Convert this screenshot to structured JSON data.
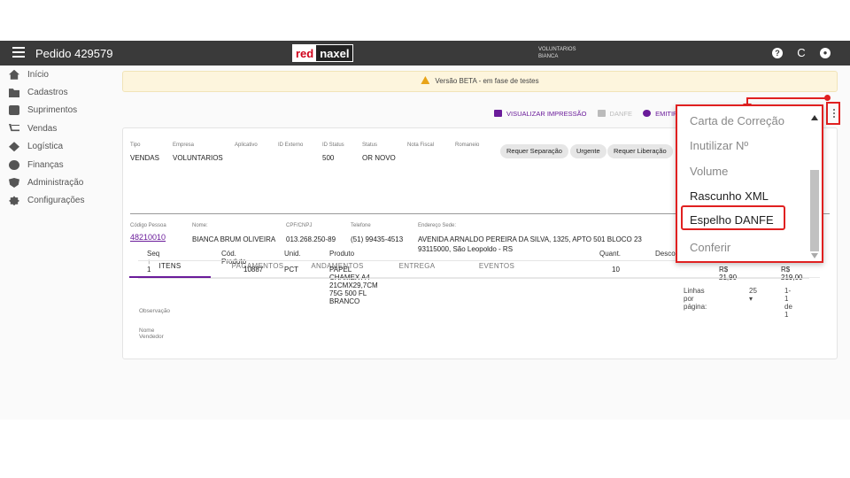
{
  "topbar": {
    "title": "Pedido 429579",
    "logo_red": "red",
    "logo_black": "naxel",
    "user_line1": "VOLUNTARIOS",
    "user_line2": "BIANCA",
    "help_glyph": "?",
    "refresh_glyph": "C",
    "account_glyph": "●"
  },
  "sidebar": {
    "items": [
      {
        "label": "Início",
        "icon": "home-icon"
      },
      {
        "label": "Cadastros",
        "icon": "folder-icon"
      },
      {
        "label": "Suprimentos",
        "icon": "box-icon"
      },
      {
        "label": "Vendas",
        "icon": "cart-icon"
      },
      {
        "label": "Logística",
        "icon": "diamond-icon"
      },
      {
        "label": "Finanças",
        "icon": "dollar-icon"
      },
      {
        "label": "Administração",
        "icon": "shield-icon"
      },
      {
        "label": "Configurações",
        "icon": "gear-icon"
      }
    ]
  },
  "beta_banner": "Versão BETA - em fase de testes",
  "actions": {
    "print": "VISUALIZAR IMPRESSÃO",
    "danfe": "DANFE",
    "emit": "EMITIR PE"
  },
  "order": {
    "tipo_label": "Tipo",
    "tipo": "VENDAS",
    "empresa_label": "Empresa",
    "empresa": "VOLUNTARIOS",
    "aplicativo_label": "Aplicativo",
    "id_externo_label": "ID Externo",
    "id_status_label": "ID Status",
    "id_status": "500",
    "status_label": "Status",
    "status": "OR NOVO",
    "nota_label": "Nota Fiscal",
    "romaneio_label": "Romaneio",
    "chips": [
      "Requer Separação",
      "Urgente",
      "Requer Liberação"
    ]
  },
  "customer": {
    "codigo_label": "Código Pessoa",
    "codigo": "48210010",
    "nome_label": "Nome:",
    "nome": "BIANCA BRUM OLIVEIRA",
    "cpf_label": "CPF/CNPJ",
    "cpf": "013.268.250-89",
    "telefone_label": "Telefone",
    "telefone": "(51) 99435-4513",
    "endereco_label": "Endereço Sede:",
    "endereco_1": "AVENIDA ARNALDO PEREIRA DA SILVA, 1325, APTO 501 BLOCO 23",
    "endereco_2": "93115000, São Leopoldo - RS"
  },
  "tabs": [
    "ITENS",
    "PAGAMENTOS",
    "ANDAMENTOS",
    "ENTREGA",
    "EVENTOS"
  ],
  "table": {
    "headers": [
      "Seq ↑",
      "Cód. Produto",
      "Unid.",
      "Produto",
      "Quant.",
      "Desco"
    ],
    "row": {
      "seq": "1",
      "codigo": "10887",
      "unid": "PCT",
      "produto": "PAPEL CHAMEX A4 21CMX29,7CM 75G 500 FL BRANCO",
      "quant": "10",
      "unit": "R$ 21,90",
      "total": "R$ 219,00"
    }
  },
  "pagination": {
    "label": "Linhas por página:",
    "value": "25 ▾",
    "range": "1-1 de 1"
  },
  "footer": {
    "observacao": "Observação",
    "vendedor": "Nome Vendedor"
  },
  "dropdown": {
    "items": [
      "Carta de Correção",
      "Inutilizar Nº",
      "Volume",
      "Rascunho XML",
      "Espelho DANFE",
      "Conferir"
    ]
  }
}
